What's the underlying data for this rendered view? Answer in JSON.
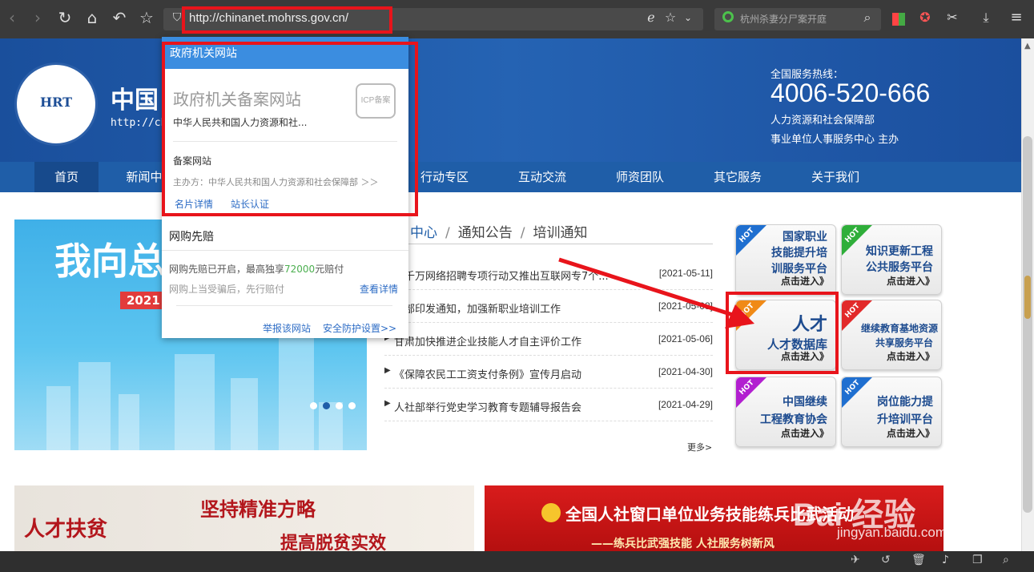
{
  "browser": {
    "url": "http://chinanet.mohrss.gov.cn/",
    "search_placeholder": "杭州杀妻分尸案开庭"
  },
  "header": {
    "logo_letters": "HRT",
    "site_name": "中国",
    "site_url": "http://chi",
    "hotline_label": "全国服务热线：",
    "hotline_number": "4006-520-666",
    "hotline_dept": "人力资源和社会保障部",
    "hotline_host": "事业单位人事服务中心 主办"
  },
  "nav": {
    "items": [
      "首页",
      "新闻中",
      "行动专区",
      "互动交流",
      "师资团队",
      "其它服务",
      "关于我们"
    ]
  },
  "banner": {
    "title": "我向总",
    "year": "2021"
  },
  "news": {
    "tabs": [
      "中心",
      "通知公告",
      "培训通知"
    ],
    "rows": [
      {
        "title": "日千万网络招聘专项行动又推出互联网专7个...",
        "date": "[2021-05-11]"
      },
      {
        "title": "社部印发通知，加强新职业培训工作",
        "date": "[2021-05-08]"
      },
      {
        "title": "甘肃加快推进企业技能人才自主评价工作",
        "date": "[2021-05-06]"
      },
      {
        "title": "《保障农民工工资支付条例》宣传月启动",
        "date": "[2021-04-30]"
      },
      {
        "title": "人社部举行党史学习教育专题辅导报告会",
        "date": "[2021-04-29]"
      }
    ],
    "more": "更多>"
  },
  "tiles": {
    "hot": "HOT",
    "enter": "点击进入》",
    "t1": {
      "l1": "国家职业",
      "l2": "技能提升培",
      "l3": "训服务平台"
    },
    "t2": {
      "l1": "知识更新工程",
      "l2": "公共服务平台"
    },
    "t3": {
      "l1": "人才",
      "l2": "人才数据库"
    },
    "t4": {
      "l1": "继续教育基地资源",
      "l2": "共享服务平台"
    },
    "t5": {
      "l1": "中国继续",
      "l2": "工程教育协会"
    },
    "t6": {
      "l1": "岗位能力提",
      "l2": "升培训平台"
    }
  },
  "popup": {
    "header": "政府机关网站",
    "cert_title": "政府机关备案网站",
    "seal": "ICP备案",
    "org": "中华人民共和国人力资源和社...",
    "type": "备案网站",
    "host": "主办方：中华人民共和国人力资源和社会保障部 ＞＞",
    "link_card": "名片详情",
    "link_verify": "站长认证",
    "section2_title": "网购先赔",
    "claim_prefix": "网购先赔已开启，最高独享",
    "claim_amount": "72000",
    "claim_suffix": "元赔付",
    "claim_sub": "网购上当受骗后，先行赔付",
    "detail": "查看详情",
    "report": "举报该网站",
    "security": "安全防护设置>>"
  },
  "bottom": {
    "left_t1": "坚持精准方略",
    "left_t2": "提高脱贫实效",
    "left_t3": "人才扶贫",
    "right_t1": "全国人社窗口单位业务技能练兵比武活动",
    "right_t2": "——练兵比武强技能  人社服务树新风"
  },
  "watermark": {
    "brand": "Bai 经验",
    "sub": "jingyan.baidu.com"
  },
  "colors": {
    "header_blue": "#1f5ea8",
    "highlight_red": "#e8141b",
    "popup_blue": "#3b8de0"
  }
}
